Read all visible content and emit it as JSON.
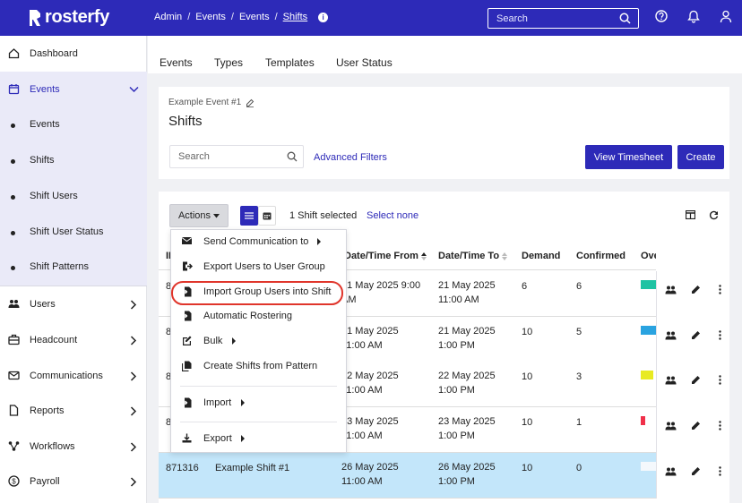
{
  "app": {
    "name": "rosterfy"
  },
  "breadcrumb": [
    "Admin",
    "Events",
    "Events",
    "Shifts"
  ],
  "search": {
    "placeholder": "Search"
  },
  "sidebar": {
    "items": [
      {
        "label": "Dashboard"
      },
      {
        "label": "Events"
      },
      {
        "label": "Users"
      },
      {
        "label": "Headcount"
      },
      {
        "label": "Communications"
      },
      {
        "label": "Reports"
      },
      {
        "label": "Workflows"
      },
      {
        "label": "Payroll"
      }
    ],
    "sub_items": [
      {
        "label": "Events"
      },
      {
        "label": "Shifts"
      },
      {
        "label": "Shift Users"
      },
      {
        "label": "Shift User Status"
      },
      {
        "label": "Shift Patterns"
      }
    ]
  },
  "content_tabs": [
    "Events",
    "Types",
    "Templates",
    "User Status"
  ],
  "page": {
    "event_name": "Example Event #1",
    "title": "Shifts",
    "search_placeholder": "Search",
    "advanced_filters": "Advanced Filters",
    "view_timesheet": "View Timesheet",
    "create": "Create"
  },
  "toolbar": {
    "actions_label": "Actions",
    "selected_text": "1 Shift selected",
    "select_none": "Select none"
  },
  "table": {
    "columns": [
      "ID",
      "Date/Time From",
      "Date/Time To",
      "Demand",
      "Confirmed",
      "Ove"
    ],
    "rows": [
      {
        "id": "8",
        "name": "",
        "from1": "21 May 2025 9:00",
        "from2": "AM",
        "to1": "21 May 2025",
        "to2": "11:00 AM",
        "demand": "6",
        "confirmed": "6",
        "overall_color": "#1fc3a3",
        "selected": false
      },
      {
        "id": "8",
        "name": "",
        "from1": "21 May 2025",
        "from2": "11:00 AM",
        "to1": "21 May 2025",
        "to2": "1:00 PM",
        "demand": "10",
        "confirmed": "5",
        "overall_color": "#2aa3e0",
        "selected": false
      },
      {
        "id": "8",
        "name": "",
        "from1": "22 May 2025",
        "from2": "11:00 AM",
        "to1": "22 May 2025",
        "to2": "1:00 PM",
        "demand": "10",
        "confirmed": "3",
        "overall_color": "#e8ea22",
        "selected": false
      },
      {
        "id": "8",
        "name": "",
        "from1": "23 May 2025",
        "from2": "11:00 AM",
        "to1": "23 May 2025",
        "to2": "1:00 PM",
        "demand": "10",
        "confirmed": "1",
        "overall_color": "#f0304a",
        "selected": false
      },
      {
        "id": "871316",
        "name": "Example Shift #1",
        "from1": "26 May 2025",
        "from2": "11:00 AM",
        "to1": "26 May 2025",
        "to2": "1:00 PM",
        "demand": "10",
        "confirmed": "0",
        "overall_color": "#ffffff",
        "selected": true
      }
    ]
  },
  "actions_menu": [
    {
      "label": "Send Communication to",
      "icon": "envelope-icon",
      "submenu": true
    },
    {
      "label": "Export Users to User Group",
      "icon": "export-icon",
      "submenu": false
    },
    {
      "label": "Import Group Users into Shift",
      "icon": "import-file-icon",
      "submenu": false,
      "highlighted": true
    },
    {
      "label": "Automatic Rostering",
      "icon": "import-file-icon",
      "submenu": false
    },
    {
      "label": "Bulk",
      "icon": "edit-icon",
      "submenu": true
    },
    {
      "label": "Create Shifts from Pattern",
      "icon": "copy-icon",
      "submenu": false
    },
    {
      "label": "Import",
      "icon": "import-file-icon",
      "submenu": true
    },
    {
      "label": "Export",
      "icon": "download-icon",
      "submenu": true
    }
  ],
  "colors": {
    "brand": "#2d2ab8",
    "highlight": "#e0352b",
    "selected_row": "#c3e6fa"
  }
}
